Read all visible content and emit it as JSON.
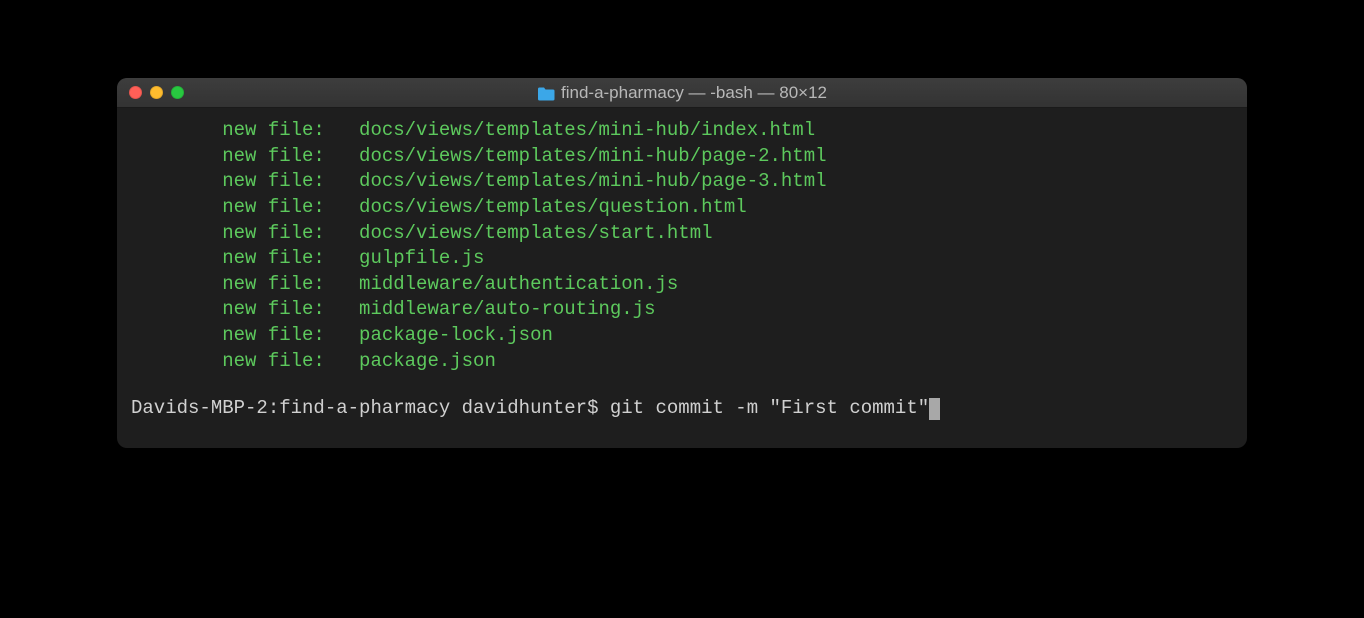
{
  "window": {
    "title": "find-a-pharmacy — -bash — 80×12"
  },
  "colors": {
    "red": "#ff5f57",
    "yellow": "#febc2e",
    "green": "#28c840",
    "terminal_green": "#5dc95d",
    "terminal_text": "#d0d0d0"
  },
  "output": {
    "status_label": "new file:",
    "files": [
      "docs/views/templates/mini-hub/index.html",
      "docs/views/templates/mini-hub/page-2.html",
      "docs/views/templates/mini-hub/page-3.html",
      "docs/views/templates/question.html",
      "docs/views/templates/start.html",
      "gulpfile.js",
      "middleware/authentication.js",
      "middleware/auto-routing.js",
      "package-lock.json",
      "package.json"
    ]
  },
  "prompt": {
    "host": "Davids-MBP-2",
    "directory": "find-a-pharmacy",
    "user": "davidhunter",
    "symbol": "$",
    "command": "git commit -m \"First commit\""
  }
}
